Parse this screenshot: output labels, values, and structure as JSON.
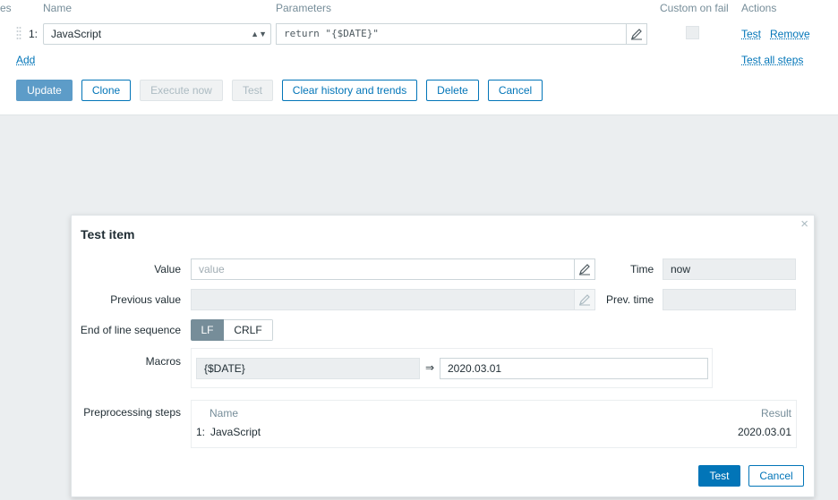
{
  "steps_table": {
    "col_steps_fragment": "es",
    "col_name": "Name",
    "col_parameters": "Parameters",
    "col_custom_on_fail": "Custom on fail",
    "col_actions": "Actions",
    "rows": [
      {
        "num": "1:",
        "type": "JavaScript",
        "param": "return \"{$DATE}\"",
        "action_test": "Test",
        "action_remove": "Remove"
      }
    ],
    "add_label": "Add",
    "test_all_label": "Test all steps"
  },
  "form_buttons": {
    "update": "Update",
    "clone": "Clone",
    "execute_now": "Execute now",
    "test": "Test",
    "clear_history": "Clear history and trends",
    "delete": "Delete",
    "cancel": "Cancel"
  },
  "dialog": {
    "title": "Test item",
    "close_glyph": "×",
    "value_label": "Value",
    "value_placeholder": "value",
    "time_label": "Time",
    "time_value": "now",
    "prev_value_label": "Previous value",
    "prev_time_label": "Prev. time",
    "eol_label": "End of line sequence",
    "eol_options": [
      "LF",
      "CRLF"
    ],
    "eol_selected": "LF",
    "macros_label": "Macros",
    "macro_name": "{$DATE}",
    "macro_arrow": "⇒",
    "macro_value": "2020.03.01",
    "preproc_label": "Preprocessing steps",
    "preproc_col_name": "Name",
    "preproc_col_result": "Result",
    "preproc_rows": [
      {
        "num": "1:",
        "name": "JavaScript",
        "result": "2020.03.01"
      }
    ],
    "test_button": "Test",
    "cancel_button": "Cancel"
  }
}
